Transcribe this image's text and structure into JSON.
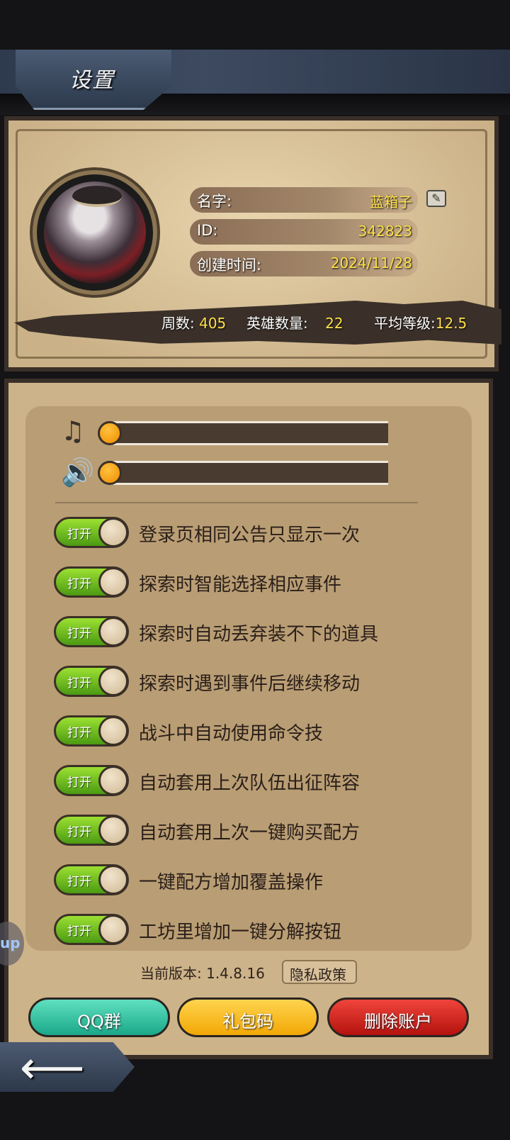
{
  "header": {
    "title": "设置"
  },
  "profile": {
    "name_label": "名字:",
    "name_value": "蓝箱子",
    "id_label": "ID:",
    "id_value": "342823",
    "created_label": "创建时间:",
    "created_value": "2024/11/28",
    "stats": {
      "weeks_label": "周数:",
      "weeks_value": "405",
      "heroes_label": "英雄数量:",
      "heroes_value": "22",
      "avg_level_label": "平均等级:",
      "avg_level_value": "12.5"
    }
  },
  "audio": {
    "music": {
      "icon": "music-note-icon",
      "level": 0
    },
    "sound": {
      "icon": "speaker-icon",
      "level": 0
    }
  },
  "options": [
    {
      "label": "登录页相同公告只显示一次",
      "toggle_text": "打开",
      "on": true
    },
    {
      "label": "探索时智能选择相应事件",
      "toggle_text": "打开",
      "on": true
    },
    {
      "label": "探索时自动丢弃装不下的道具",
      "toggle_text": "打开",
      "on": true
    },
    {
      "label": "探索时遇到事件后继续移动",
      "toggle_text": "打开",
      "on": true
    },
    {
      "label": "战斗中自动使用命令技",
      "toggle_text": "打开",
      "on": true
    },
    {
      "label": "自动套用上次队伍出征阵容",
      "toggle_text": "打开",
      "on": true
    },
    {
      "label": "自动套用上次一键购买配方",
      "toggle_text": "打开",
      "on": true
    },
    {
      "label": "一键配方增加覆盖操作",
      "toggle_text": "打开",
      "on": true
    },
    {
      "label": "工坊里增加一键分解按钮",
      "toggle_text": "打开",
      "on": true
    }
  ],
  "footer": {
    "version_text": "当前版本: 1.4.8.16",
    "privacy_label": "隐私政策",
    "qq_label": "QQ群",
    "gift_label": "礼包码",
    "delete_label": "删除账户"
  },
  "side_badge": "up",
  "colors": {
    "panel": "#cdb389",
    "value_yellow": "#ffe04a",
    "toggle_on": "#6cc11f",
    "qq": "#2bbf9c",
    "gift": "#f5b815",
    "delete": "#d0201a"
  }
}
